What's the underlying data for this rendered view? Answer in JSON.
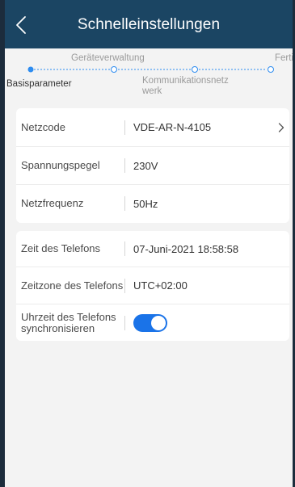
{
  "header": {
    "title": "Schnelleinstellungen"
  },
  "stepper": {
    "steps": [
      {
        "label": "Basisparameter",
        "state": "active"
      },
      {
        "label": "Geräteverwaltung",
        "state": "pending"
      },
      {
        "label": "Kommunikationsnetz werk",
        "state": "pending"
      },
      {
        "label": "Fertig",
        "state": "pending"
      }
    ]
  },
  "grid_settings": [
    {
      "label": "Netzcode",
      "value": "VDE-AR-N-4105"
    },
    {
      "label": "Spannungspegel",
      "value": "230V"
    },
    {
      "label": "Netzfrequenz",
      "value": "50Hz"
    }
  ],
  "time_settings": {
    "phone_time": {
      "label": "Zeit des Telefons",
      "value": "07-Juni-2021 18:58:58"
    },
    "phone_timezone": {
      "label": "Zeitzone des Telefons",
      "value": "UTC+02:00"
    },
    "sync": {
      "label": "Uhrzeit des Telefons synchronisieren",
      "enabled": true
    }
  },
  "colors": {
    "header_bg": "#1b4563",
    "accent": "#1a73e8",
    "step_active": "#2d8cf0"
  },
  "icons": {
    "back": "chevron-left-icon",
    "row_arrow": "chevron-right-icon"
  }
}
